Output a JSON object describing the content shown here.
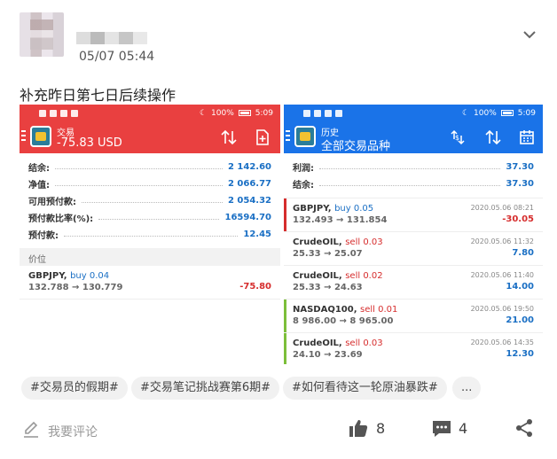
{
  "post": {
    "time": "05/07 05:44",
    "text": "补充昨日第七日后续操作"
  },
  "left_phone": {
    "status": {
      "battery": "100%",
      "clock": "5:09"
    },
    "appbar_small": "交易",
    "appbar_big": "-75.83 USD",
    "summary": [
      {
        "label": "结余:",
        "value": "2 142.60"
      },
      {
        "label": "净值:",
        "value": "2 066.77"
      },
      {
        "label": "可用预付款:",
        "value": "2 054.32"
      },
      {
        "label": "预付款比率(%):",
        "value": "16594.70"
      },
      {
        "label": "预付款:",
        "value": "12.45"
      }
    ],
    "section": "价位",
    "positions": [
      {
        "symbol": "GBPJPY,",
        "side": "buy 0.04",
        "prices": "132.788 → 130.779",
        "profit": "-75.80"
      }
    ]
  },
  "right_phone": {
    "status": {
      "battery": "100%",
      "clock": "5:09"
    },
    "appbar_small": "历史",
    "appbar_big": "全部交易品种",
    "summary": [
      {
        "label": "利润:",
        "value": "37.30"
      },
      {
        "label": "结余:",
        "value": "37.30"
      }
    ],
    "trades": [
      {
        "symbol": "GBPJPY,",
        "side": "buy 0.05",
        "date": "2020.05.06 08:21",
        "prices": "132.493 → 131.854",
        "profit": "-30.05"
      },
      {
        "symbol": "CrudeOIL,",
        "side": "sell 0.03",
        "date": "2020.05.06 11:32",
        "prices": "25.33 → 25.07",
        "profit": "7.80"
      },
      {
        "symbol": "CrudeOIL,",
        "side": "sell 0.02",
        "date": "2020.05.06 11:40",
        "prices": "25.33 → 24.63",
        "profit": "14.00"
      },
      {
        "symbol": "NASDAQ100,",
        "side": "sell 0.01",
        "date": "2020.05.06 19:50",
        "prices": "8 986.00 → 8 965.00",
        "profit": "21.00"
      },
      {
        "symbol": "CrudeOIL,",
        "side": "sell 0.03",
        "date": "2020.05.06 14:35",
        "prices": "24.10 → 23.69",
        "profit": "12.30"
      }
    ]
  },
  "tags": [
    "#交易员的假期#",
    "#交易笔记挑战赛第6期#",
    "#如何看待这一轮原油暴跌#",
    "..."
  ],
  "actions": {
    "comment_placeholder": "我要评论",
    "likes": "8",
    "comments": "4"
  },
  "colors": {
    "trade_red": "#e94040",
    "history_blue": "#1a73e8",
    "value_blue": "#1a6fc4",
    "loss_red": "#d62d2d"
  }
}
